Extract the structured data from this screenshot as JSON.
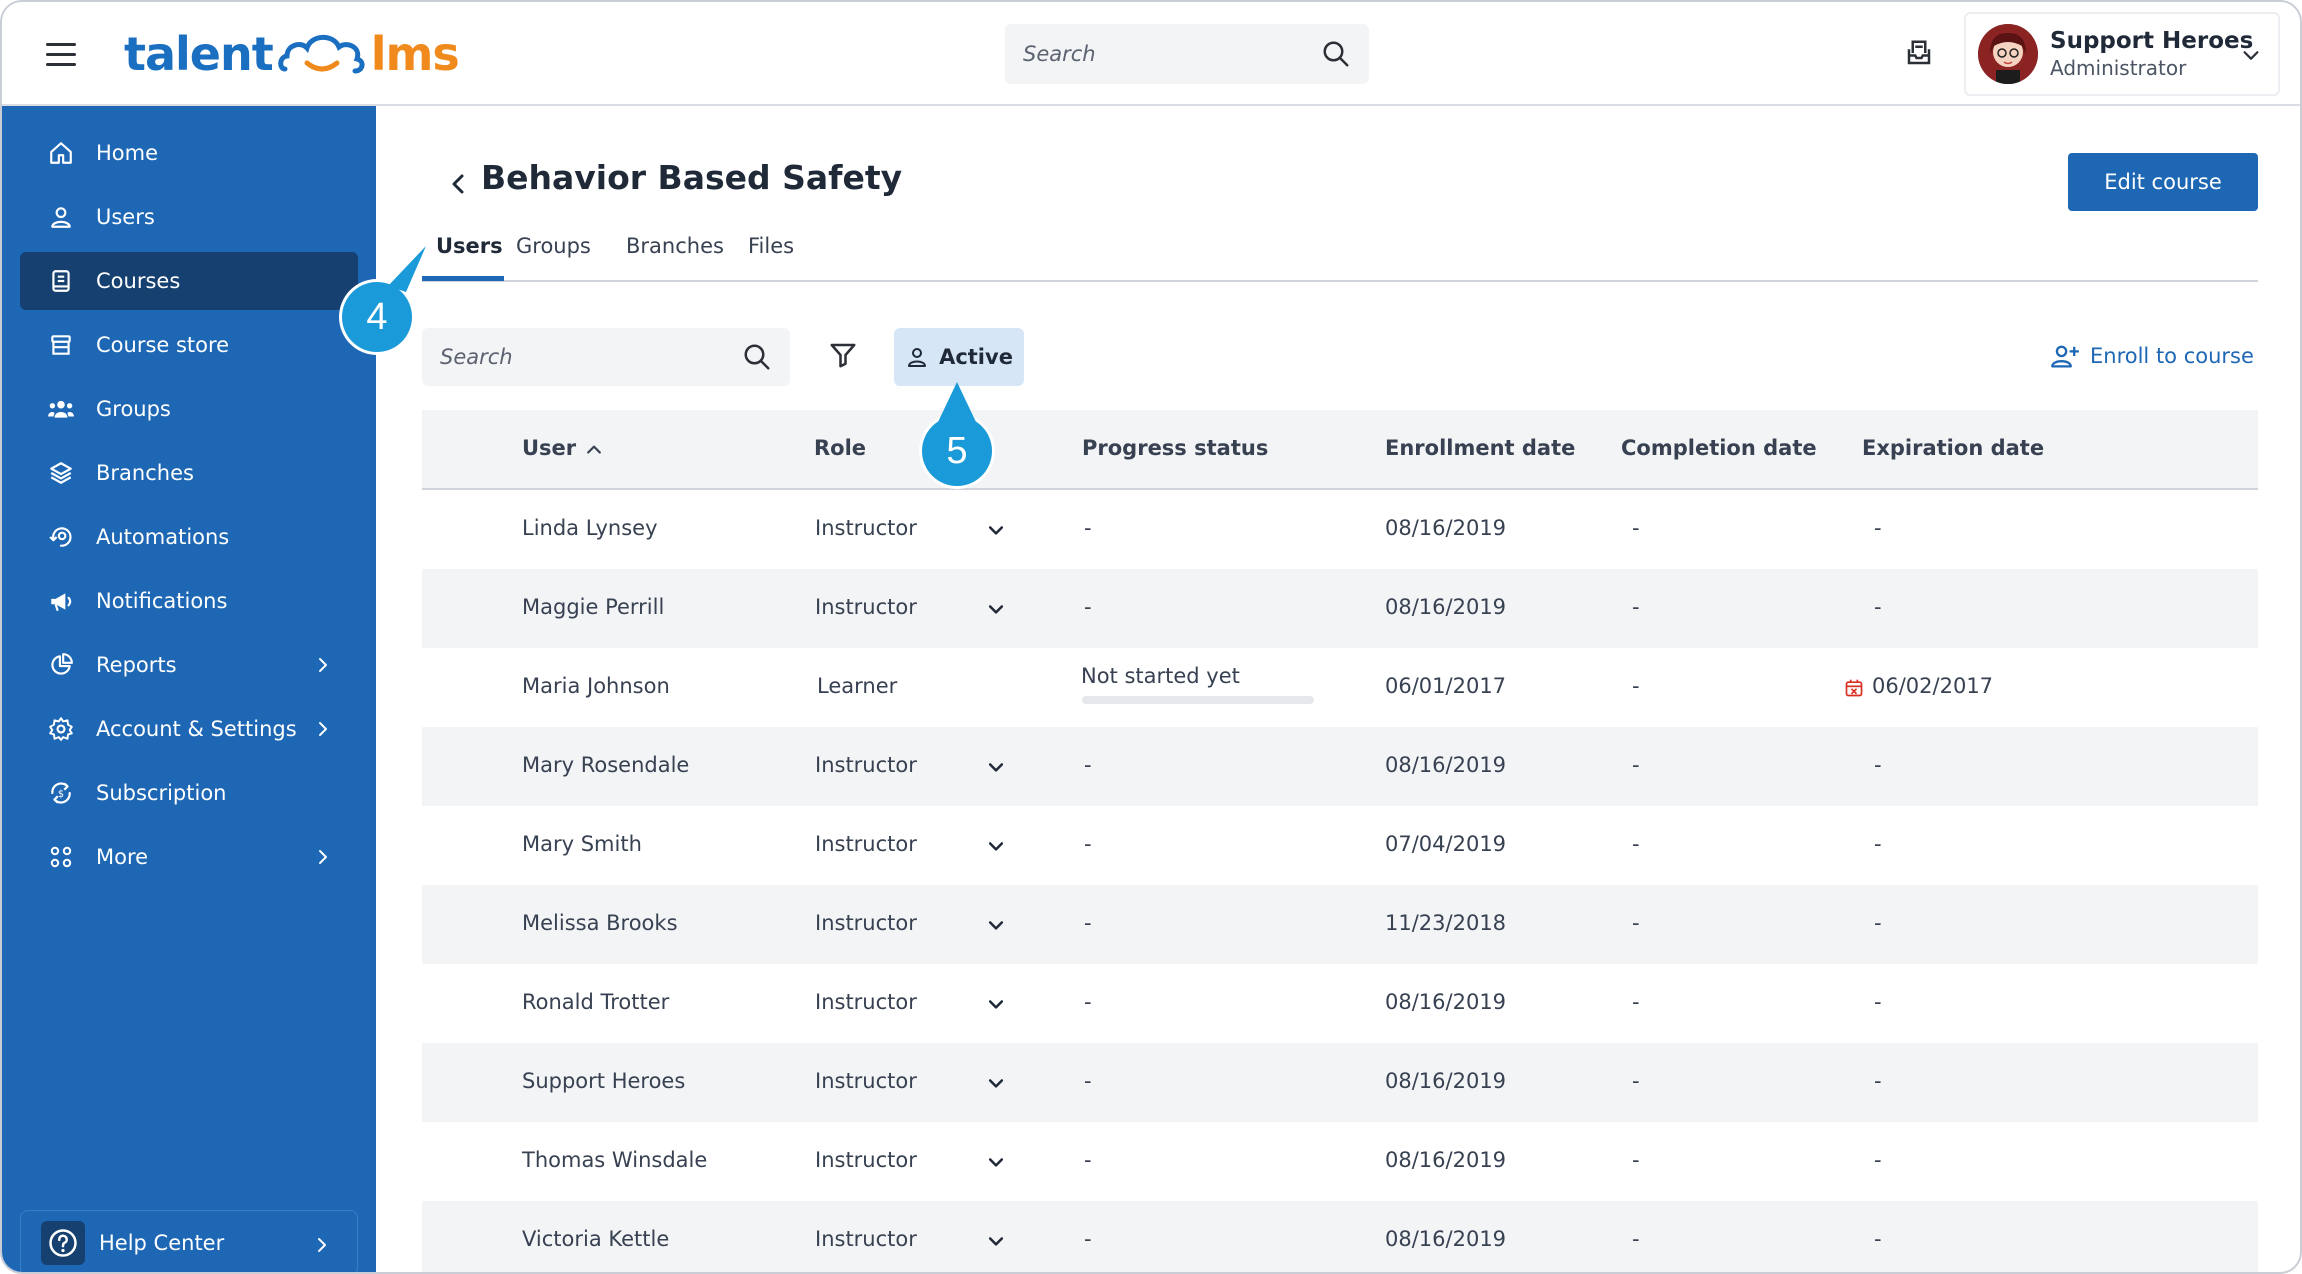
{
  "brand": {
    "logo_part1": "talent",
    "logo_part2": "lms",
    "primary_color": "#1d67b4",
    "accent_color": "#f08a1c"
  },
  "header": {
    "search_placeholder": "Search",
    "user_name": "Support Heroes",
    "user_role": "Administrator"
  },
  "sidebar": {
    "items": [
      {
        "label": "Home",
        "icon": "home-icon"
      },
      {
        "label": "Users",
        "icon": "user-icon"
      },
      {
        "label": "Courses",
        "icon": "book-icon",
        "active": true
      },
      {
        "label": "Course store",
        "icon": "store-icon"
      },
      {
        "label": "Groups",
        "icon": "groups-icon"
      },
      {
        "label": "Branches",
        "icon": "layers-icon"
      },
      {
        "label": "Automations",
        "icon": "automation-icon"
      },
      {
        "label": "Notifications",
        "icon": "megaphone-icon"
      },
      {
        "label": "Reports",
        "icon": "pie-chart-icon",
        "has_submenu": true
      },
      {
        "label": "Account & Settings",
        "icon": "gear-icon",
        "has_submenu": true
      },
      {
        "label": "Subscription",
        "icon": "subscription-icon"
      },
      {
        "label": "More",
        "icon": "grid-icon",
        "has_submenu": true
      }
    ],
    "help_center": "Help Center"
  },
  "page": {
    "title": "Behavior Based Safety",
    "edit_button": "Edit course",
    "tabs": [
      "Users",
      "Groups",
      "Branches",
      "Files"
    ],
    "active_tab": "Users"
  },
  "toolbar": {
    "search_placeholder": "Search",
    "status_filter": "Active",
    "enroll_link": "Enroll to course"
  },
  "callouts": {
    "marker_4": "4",
    "marker_5": "5"
  },
  "table": {
    "columns": [
      "User",
      "Role",
      "Progress status",
      "Enrollment date",
      "Completion date",
      "Expiration date"
    ],
    "rows": [
      {
        "user": "Linda Lynsey",
        "role": "Instructor",
        "progress": "-",
        "enrolled": "08/16/2019",
        "completed": "-",
        "expires": "-"
      },
      {
        "user": "Maggie Perrill",
        "role": "Instructor",
        "progress": "-",
        "enrolled": "08/16/2019",
        "completed": "-",
        "expires": "-"
      },
      {
        "user": "Maria Johnson",
        "role": "Learner",
        "progress": "Not started yet",
        "progress_value": 0,
        "enrolled": "06/01/2017",
        "completed": "-",
        "expires": "06/02/2017",
        "expired": true
      },
      {
        "user": "Mary Rosendale",
        "role": "Instructor",
        "progress": "-",
        "enrolled": "08/16/2019",
        "completed": "-",
        "expires": "-"
      },
      {
        "user": "Mary Smith",
        "role": "Instructor",
        "progress": "-",
        "enrolled": "07/04/2019",
        "completed": "-",
        "expires": "-"
      },
      {
        "user": "Melissa Brooks",
        "role": "Instructor",
        "progress": "-",
        "enrolled": "11/23/2018",
        "completed": "-",
        "expires": "-"
      },
      {
        "user": "Ronald Trotter",
        "role": "Instructor",
        "progress": "-",
        "enrolled": "08/16/2019",
        "completed": "-",
        "expires": "-"
      },
      {
        "user": "Support Heroes",
        "role": "Instructor",
        "progress": "-",
        "enrolled": "08/16/2019",
        "completed": "-",
        "expires": "-"
      },
      {
        "user": "Thomas Winsdale",
        "role": "Instructor",
        "progress": "-",
        "enrolled": "08/16/2019",
        "completed": "-",
        "expires": "-"
      },
      {
        "user": "Victoria Kettle",
        "role": "Instructor",
        "progress": "-",
        "enrolled": "08/16/2019",
        "completed": "-",
        "expires": "-"
      }
    ]
  }
}
